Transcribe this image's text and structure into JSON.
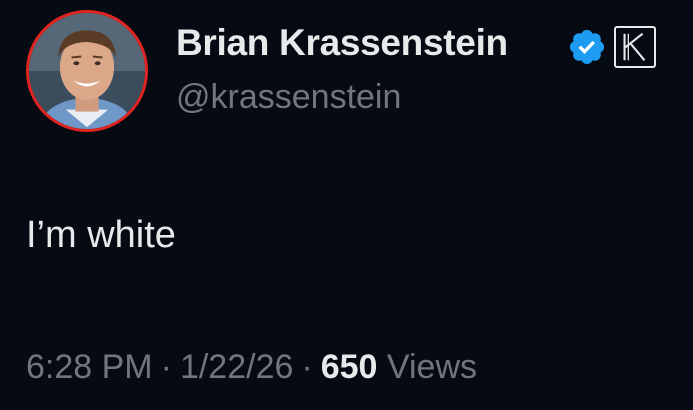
{
  "author": {
    "display_name": "Brian Krassenstein",
    "handle": "@krassenstein",
    "avatar_icon": "profile-photo",
    "verified_icon": "verified-badge-icon",
    "affiliate_icon": "k-affiliate-badge-icon"
  },
  "tweet": {
    "text": "I’m white"
  },
  "meta": {
    "time": "6:28 PM",
    "separator": "·",
    "date": "1/22/26",
    "views_count": "650",
    "views_label": "Views"
  },
  "colors": {
    "background": "#050a13",
    "primary_text": "#e7e9ea",
    "secondary_text": "#71767b",
    "verified_blue": "#1d9bf0",
    "avatar_ring": "#e0241f"
  }
}
